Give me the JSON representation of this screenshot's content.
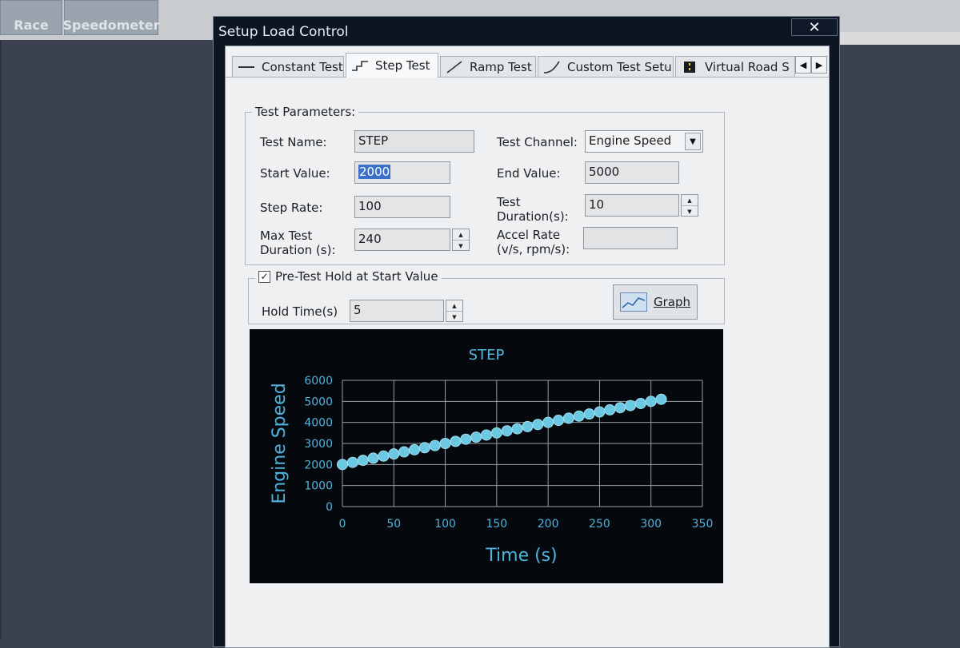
{
  "background_app": {
    "tabs": [
      {
        "label": "Race"
      },
      {
        "label": "Speedometer"
      }
    ]
  },
  "dialog": {
    "title": "Setup Load Control",
    "close_glyph": "✕"
  },
  "tabs": [
    {
      "label": "Constant Test",
      "icon": "constant-line-icon"
    },
    {
      "label": "Step Test",
      "icon": "step-line-icon",
      "active": true
    },
    {
      "label": "Ramp Test",
      "icon": "ramp-line-icon"
    },
    {
      "label": "Custom Test Setup",
      "icon": "curve-line-icon"
    },
    {
      "label": "Virtual Road S",
      "icon": "road-icon"
    }
  ],
  "tab_scroll": {
    "left": "◀",
    "right": "▶"
  },
  "test_parameters": {
    "group_title": "Test Parameters:",
    "test_name_label": "Test Name:",
    "test_name_value": "STEP",
    "start_value_label": "Start Value:",
    "start_value": "2000",
    "step_rate_label": "Step Rate:",
    "step_rate_value": "100",
    "max_duration_label_1": "Max Test",
    "max_duration_label_2": "Duration (s):",
    "max_duration_value": "240",
    "test_channel_label": "Test Channel:",
    "test_channel_value": "Engine Speed",
    "end_value_label": "End Value:",
    "end_value": "5000",
    "test_duration_label_1": "Test",
    "test_duration_label_2": "Duration(s):",
    "test_duration_value": "10",
    "accel_rate_label_1": "Accel Rate",
    "accel_rate_label_2": "(v/s, rpm/s):",
    "accel_rate_value": ""
  },
  "pretest": {
    "checkbox_label": "Pre-Test Hold at Start Value",
    "checked": true,
    "hold_time_label": "Hold Time(s)",
    "hold_time_value": "5",
    "graph_button_label": "Graph"
  },
  "colors": {
    "chart_bg": "#05080d",
    "point_color": "#6ac8e2",
    "axis_text": "#4fb3dc",
    "title_text": "#52b8e0",
    "grid": "#9aa0a8"
  },
  "chart_data": {
    "type": "scatter",
    "title": "STEP",
    "xlabel": "Time (s)",
    "ylabel": "Engine Speed",
    "xlim": [
      0,
      350
    ],
    "ylim": [
      0,
      6000
    ],
    "xticks": [
      0,
      50,
      100,
      150,
      200,
      250,
      300,
      350
    ],
    "yticks": [
      0,
      1000,
      2000,
      3000,
      4000,
      5000,
      6000
    ],
    "grid": true,
    "series": [
      {
        "x": [
          0,
          10,
          20,
          30,
          40,
          50,
          60,
          70,
          80,
          90,
          100,
          110,
          120,
          130,
          140,
          150,
          160,
          170,
          180,
          190,
          200,
          210,
          220,
          230,
          240,
          250,
          260,
          270,
          280,
          290,
          300,
          310
        ],
        "y": [
          2000,
          2100,
          2200,
          2300,
          2400,
          2500,
          2600,
          2700,
          2800,
          2900,
          3000,
          3100,
          3200,
          3300,
          3400,
          3500,
          3600,
          3700,
          3800,
          3900,
          4000,
          4100,
          4200,
          4300,
          4400,
          4500,
          4600,
          4700,
          4800,
          4900,
          5000,
          5100
        ]
      }
    ]
  }
}
